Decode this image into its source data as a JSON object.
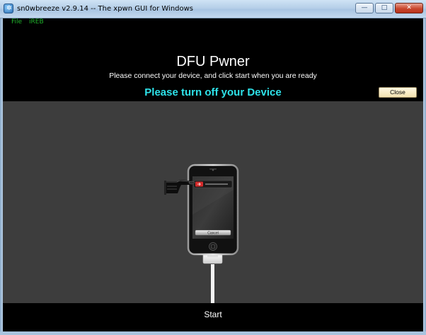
{
  "window": {
    "title": "sn0wbreeze v2.9.14 -- The xpwn GUI for Windows",
    "buttons": {
      "minimize": "—",
      "maximize": "□",
      "close": "✕"
    }
  },
  "menu": {
    "items": [
      "File",
      "iREB"
    ]
  },
  "header": {
    "title": "DFU Pwner",
    "subtitle": "Please connect your device, and click start when you are ready",
    "status": "Please turn off your Device",
    "close_label": "Close"
  },
  "device": {
    "cancel_label": "Cancel"
  },
  "footer": {
    "start_label": "Start"
  },
  "colors": {
    "menu_text": "#1fb32a",
    "status_text": "#2ee2e9",
    "content_bg": "#3d3d3d",
    "slider_red": "#d42b2b"
  }
}
